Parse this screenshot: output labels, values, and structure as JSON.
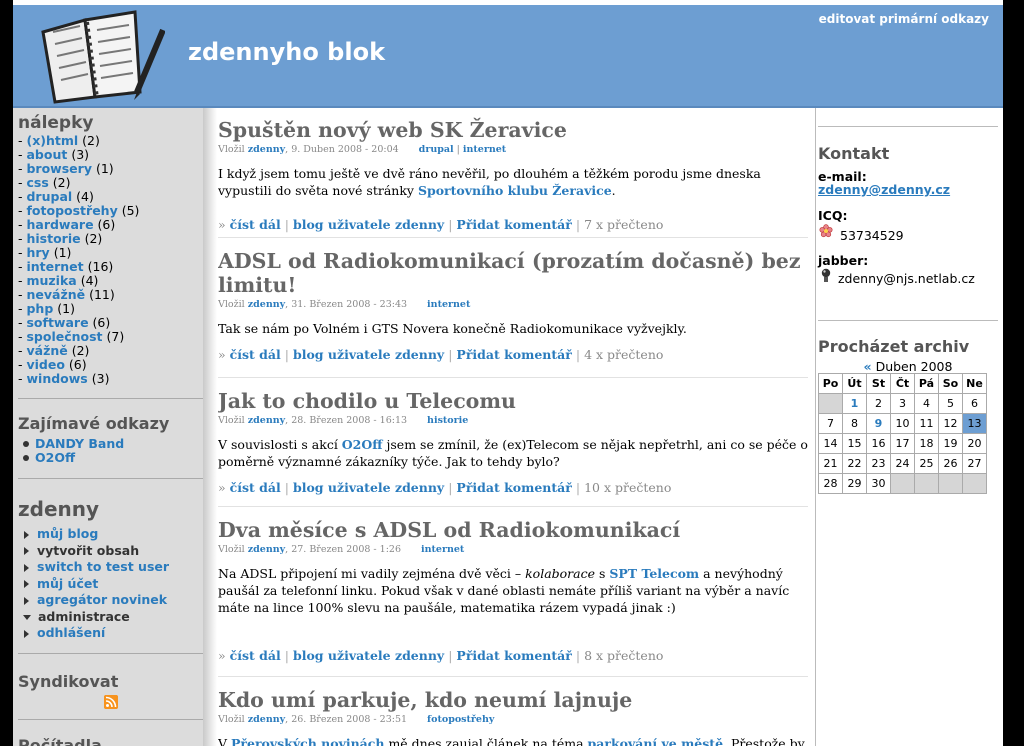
{
  "header": {
    "site_name": "zdennyho blok",
    "primary_links": "editovat primární odkazy"
  },
  "left": {
    "tags_title": "nálepky",
    "tags": [
      {
        "name": "(x)html",
        "count": "(2)"
      },
      {
        "name": "about",
        "count": "(3)"
      },
      {
        "name": "browsery",
        "count": "(1)"
      },
      {
        "name": "css",
        "count": "(2)"
      },
      {
        "name": "drupal",
        "count": "(4)"
      },
      {
        "name": "fotopostřehy",
        "count": "(5)"
      },
      {
        "name": "hardware",
        "count": "(6)"
      },
      {
        "name": "historie",
        "count": "(2)"
      },
      {
        "name": "hry",
        "count": "(1)"
      },
      {
        "name": "internet",
        "count": "(16)"
      },
      {
        "name": "muzika",
        "count": "(4)"
      },
      {
        "name": "nevážně",
        "count": "(11)"
      },
      {
        "name": "php",
        "count": "(1)"
      },
      {
        "name": "software",
        "count": "(6)"
      },
      {
        "name": "společnost",
        "count": "(7)"
      },
      {
        "name": "vážně",
        "count": "(2)"
      },
      {
        "name": "video",
        "count": "(6)"
      },
      {
        "name": "windows",
        "count": "(3)"
      }
    ],
    "links_title": "Zajímavé odkazy",
    "links": [
      "DANDY Band",
      "O2Off"
    ],
    "user_title": "zdenny",
    "user_menu": [
      "můj blog",
      "vytvořit obsah",
      "switch to test user",
      "můj účet",
      "agregátor novinek",
      "administrace",
      "odhlášení"
    ],
    "syndicate_title": "Syndikovat",
    "next_title": "Počítadla"
  },
  "posts": [
    {
      "title": "Spuštěn nový web SK Žeravice",
      "meta_prefix": "Vložil",
      "author": "zdenny",
      "date": ", 9. Duben 2008 - 20:04",
      "tags": [
        "drupal",
        "internet"
      ],
      "body_1": "I když jsem tomu ještě ve dvě ráno nevěřil, po dlouhém a těžkém porodu jsme dneska vypustili do světa nové stránky ",
      "body_link": "Sportovního klubu Žeravice",
      "body_2": ".",
      "read_more": "číst dál",
      "user_blog": "blog uživatele zdenny",
      "add_comment": "Přidat komentář",
      "reads": "7 x přečteno"
    },
    {
      "title": "ADSL od Radiokomunikací (prozatím dočasně) bez limitu!",
      "meta_prefix": "Vložil",
      "author": "zdenny",
      "date": ", 31. Březen 2008 - 23:43",
      "tags": [
        "internet"
      ],
      "body_1": "Tak se nám po Volném i GTS Novera konečně Radiokomunikace vyžvejkly.",
      "read_more": "číst dál",
      "user_blog": "blog uživatele zdenny",
      "add_comment": "Přidat komentář",
      "reads": "4 x přečteno"
    },
    {
      "title": "Jak to chodilo u Telecomu",
      "meta_prefix": "Vložil",
      "author": "zdenny",
      "date": ", 28. Březen 2008 - 16:13",
      "tags": [
        "historie"
      ],
      "body_1": "V souvislosti s akcí ",
      "body_link": "O2Off",
      "body_2": " jsem se zmínil, že (ex)Telecom se nějak nepřetrhl, ani co se péče o poměrně významné zákazníky týče. Jak to tehdy bylo?",
      "read_more": "číst dál",
      "user_blog": "blog uživatele zdenny",
      "add_comment": "Přidat komentář",
      "reads": "10 x přečteno"
    },
    {
      "title": "Dva měsíce s ADSL od Radiokomunikací",
      "meta_prefix": "Vložil",
      "author": "zdenny",
      "date": ", 27. Březen 2008 - 1:26",
      "tags": [
        "internet"
      ],
      "body_1": "Na ADSL připojení mi vadily zejména dvě věci – ",
      "body_em": "kolaborace",
      "body_mid": " s ",
      "body_link": "SPT Telecom",
      "body_2": " a nevýhodný paušál za telefonní linku. Pokud však v dané oblasti nemáte příliš variant na výběr a navíc máte na lince 100% slevu na paušále, matematika rázem vypadá jinak :)",
      "read_more": "číst dál",
      "user_blog": "blog uživatele zdenny",
      "add_comment": "Přidat komentář",
      "reads": "8 x přečteno"
    },
    {
      "title": "Kdo umí parkuje, kdo neumí lajnuje",
      "meta_prefix": "Vložil",
      "author": "zdenny",
      "date": ", 26. Březen 2008 - 23:51",
      "tags": [
        "fotopostřehy"
      ],
      "body_1": "V ",
      "body_link": "Přerovských novinách",
      "body_2": " mě dnes zaujal článek na téma ",
      "body_link2": "parkování ve městě",
      "body_3": ". Přestože by se s"
    }
  ],
  "right": {
    "contact_title": "Kontakt",
    "email_label": "e-mail:",
    "email": "zdenny@zdenny.cz",
    "icq_label": "ICQ:",
    "icq": "53734529",
    "jabber_label": "jabber:",
    "jabber": "zdenny@njs.netlab.cz",
    "archive_title": "Procházet archiv",
    "cal_prev": "«",
    "cal_month": "Duben 2008",
    "cal_days": [
      "Po",
      "Út",
      "St",
      "Čt",
      "Pá",
      "So",
      "Ne"
    ],
    "cal_weeks": [
      [
        "",
        "1",
        "2",
        "3",
        "4",
        "5",
        "6"
      ],
      [
        "7",
        "8",
        "9",
        "10",
        "11",
        "12",
        "13"
      ],
      [
        "14",
        "15",
        "16",
        "17",
        "18",
        "19",
        "20"
      ],
      [
        "21",
        "22",
        "23",
        "24",
        "25",
        "26",
        "27"
      ],
      [
        "28",
        "29",
        "30",
        "",
        "",
        "",
        ""
      ]
    ],
    "cal_links": [
      "1",
      "9"
    ],
    "cal_today": "13"
  },
  "colors": {
    "header_bg": "#6d9ed2",
    "link": "#2a7bbd",
    "sidebar_bg": "#dcdcdc"
  }
}
